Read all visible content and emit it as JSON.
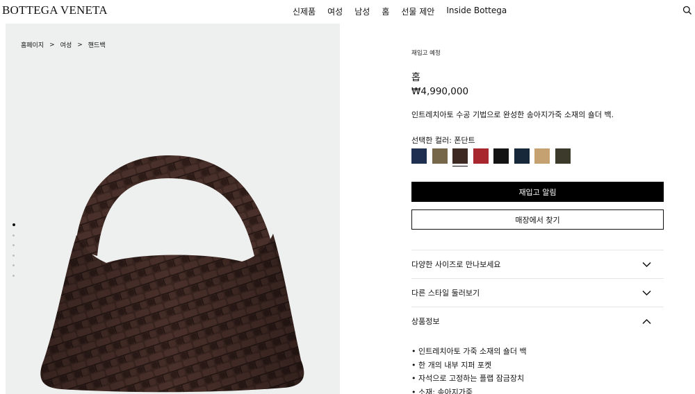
{
  "header": {
    "logo": "BOTTEGA VENETA",
    "nav": [
      "신제품",
      "여성",
      "남성",
      "홈",
      "선물 제안",
      "Inside Bottega"
    ]
  },
  "breadcrumb": [
    "홈페이지",
    "여성",
    "핸드백"
  ],
  "gallery": {
    "image_count": 6,
    "active_index": 0
  },
  "product": {
    "restock_label": "재입고 예정",
    "name": "홉",
    "price": "₩4,990,000",
    "description": "인트레치아토 수공 기법으로 완성한 송아지가죽 소재의 숄더 백.",
    "color_label": "선택한 컬러: 폰단트",
    "swatches": [
      {
        "color": "#1f2f4f"
      },
      {
        "color": "#76664a"
      },
      {
        "color": "#3d2a22",
        "selected": true
      },
      {
        "color": "#a8262d"
      },
      {
        "color": "#131313"
      },
      {
        "color": "#17283b"
      },
      {
        "color": "#c5a070"
      },
      {
        "color": "#3b3a2b"
      }
    ],
    "notify_button": "재입고 알림",
    "store_button": "매장에서 찾기"
  },
  "accordions": [
    {
      "title": "다양한 사이즈로 만나보세요",
      "open": false
    },
    {
      "title": "다른 스타일 둘러보기",
      "open": false
    },
    {
      "title": "상품정보",
      "open": true
    }
  ],
  "details": [
    "인트레치아토 가죽 소재의 숄더 백",
    "한 개의 내부 지퍼 포켓",
    "자석으로 고정하는 플랩 잠금장치",
    "소재: 송아지가죽"
  ]
}
